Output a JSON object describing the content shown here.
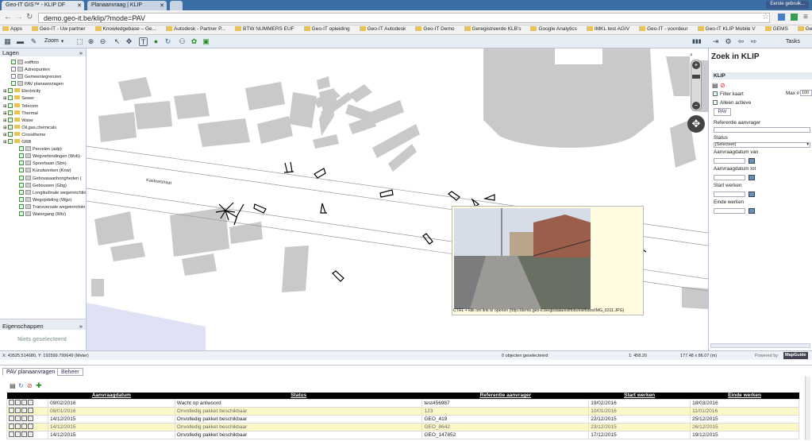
{
  "browser": {
    "tabs": [
      {
        "label": "Geo-IT GIS™ - KLIP DF"
      },
      {
        "label": "Planaanvraag | KLIP"
      }
    ],
    "user_chip": "Eerste gebruik...",
    "url": "demo.geo-it.be/klip/?mode=PAV",
    "bookmarks": [
      "Apps",
      "Geo-IT - Uw partner",
      "Knowledgebase – Ge...",
      "Autodesk - Partner P...",
      "BTW NUMMERS EUF",
      "Geo-IT opleiding",
      "Geo-IT Autodesk",
      "Geo-IT Demo",
      "Geregistreerde KLB's",
      "Google Analytics",
      "IMKL test AGIV",
      "Geo-IT - voordeur",
      "Geo-IT KLIP Mobile V",
      "GEMS",
      "Geo-IT GIS preview"
    ]
  },
  "toolbar": {
    "zoom_label": "Zoom",
    "tasks_label": "Tasks"
  },
  "layers_panel": {
    "title": "Lagen",
    "layers": [
      {
        "label": "exiffoto",
        "indent": 1,
        "checked": true,
        "kind": "icon"
      },
      {
        "label": "Adrespunten",
        "indent": 1,
        "checked": false,
        "kind": "icon"
      },
      {
        "label": "Gemeentegrenzen",
        "indent": 1,
        "checked": false,
        "kind": "icon"
      },
      {
        "label": "PAV planaanvragen",
        "indent": 1,
        "checked": true,
        "kind": "icon"
      },
      {
        "label": "Electricity",
        "indent": 0,
        "checked": true,
        "kind": "folder"
      },
      {
        "label": "Sewer",
        "indent": 0,
        "checked": true,
        "kind": "folder"
      },
      {
        "label": "Telecom",
        "indent": 0,
        "checked": true,
        "kind": "folder"
      },
      {
        "label": "Thermal",
        "indent": 0,
        "checked": true,
        "kind": "folder"
      },
      {
        "label": "Water",
        "indent": 0,
        "checked": true,
        "kind": "folder"
      },
      {
        "label": "Oil,gas,chemicals",
        "indent": 0,
        "checked": true,
        "kind": "folder"
      },
      {
        "label": "Crosstheme",
        "indent": 0,
        "checked": true,
        "kind": "folder"
      },
      {
        "label": "GRB",
        "indent": 0,
        "checked": true,
        "kind": "folder"
      },
      {
        "label": "Percelen (adp)",
        "indent": 2,
        "checked": true,
        "kind": "swatch"
      },
      {
        "label": "Wegverbindingen (Wvb)",
        "indent": 2,
        "checked": true,
        "kind": "swatch"
      },
      {
        "label": "Spoorbaan (Sbn)",
        "indent": 2,
        "checked": true,
        "kind": "swatch"
      },
      {
        "label": "Kunstwerken (Knw)",
        "indent": 2,
        "checked": true,
        "kind": "swatch"
      },
      {
        "label": "Gebouwaanhorigheden (",
        "indent": 2,
        "checked": true,
        "kind": "swatch"
      },
      {
        "label": "Gebouwen (Gbg)",
        "indent": 2,
        "checked": true,
        "kind": "swatch"
      },
      {
        "label": "Longitudinale wegeinrichtin",
        "indent": 2,
        "checked": true,
        "kind": "swatch"
      },
      {
        "label": "Wegopdeling (Wgo)",
        "indent": 2,
        "checked": true,
        "kind": "swatch"
      },
      {
        "label": "Transversale wegeinrichtin",
        "indent": 2,
        "checked": true,
        "kind": "swatch"
      },
      {
        "label": "Watergang (Wtz)",
        "indent": 2,
        "checked": true,
        "kind": "swatch"
      }
    ]
  },
  "properties_panel": {
    "title": "Eigenschappen",
    "empty_text": "Niets geselecteerd"
  },
  "map": {
    "street_label": "Kasteelstraat",
    "photo_caption": "CTRL + klik om link te openen (http://demo.geo-it.be/gisdata/exiffoto/exiffotos/IMG_0311.JPG)"
  },
  "search_panel": {
    "title": "Zoek in KLIP",
    "section": "KLIP",
    "filter_kaart": "Filter kaart",
    "alleen_actieve": "Alleen actieve",
    "max_label": "Max #",
    "max_value": "100",
    "pav_button": "PAV",
    "referentie_label": "Referentie aanvrager",
    "status_label": "Status",
    "status_value": "[Selecteer]",
    "aanvraagdatum_van": "Aanvraagdatum van",
    "aanvraagdatum_tot": "Aanvraagdatum tot",
    "start_werken": "Start werken",
    "einde_werken": "Einde werken"
  },
  "statusbar": {
    "coords": "X: 43525.514680, Y: 192599.799649 (Meter)",
    "selected": "0 objecten geselecteerd",
    "scale": "1: 458.20",
    "size": "177.48 x 86.07 (m)",
    "powered": "Powered by",
    "mapguide": "MapGuide"
  },
  "bottom_panel": {
    "tabs": [
      "PAV planaanvragen",
      "Beheer"
    ],
    "columns": [
      "Aanvraagdatum",
      "Status",
      "Referentie aanvrager",
      "Start werken",
      "Einde werken"
    ],
    "rows": [
      {
        "aanvraagdatum": "09/02/2016",
        "status": "Wacht op antwoord",
        "referentie": "test456987",
        "start": "19/02/2016",
        "einde": "18/03/2016"
      },
      {
        "aanvraagdatum": "08/01/2016",
        "status": "Onvolledig pakket beschikbaar",
        "referentie": "123",
        "start": "10/01/2016",
        "einde": "11/01/2016"
      },
      {
        "aanvraagdatum": "14/12/2015",
        "status": "Onvolledig pakket beschikbaar",
        "referentie": "GEO_419",
        "start": "22/12/2015",
        "einde": "25/12/2015"
      },
      {
        "aanvraagdatum": "14/12/2015",
        "status": "Onvolledig pakket beschikbaar",
        "referentie": "GEO_8642",
        "start": "23/12/2015",
        "einde": "26/12/2015"
      },
      {
        "aanvraagdatum": "14/12/2015",
        "status": "Onvolledig pakket beschikbaar",
        "referentie": "GEO_147852",
        "start": "17/12/2015",
        "einde": "19/12/2015"
      }
    ]
  }
}
